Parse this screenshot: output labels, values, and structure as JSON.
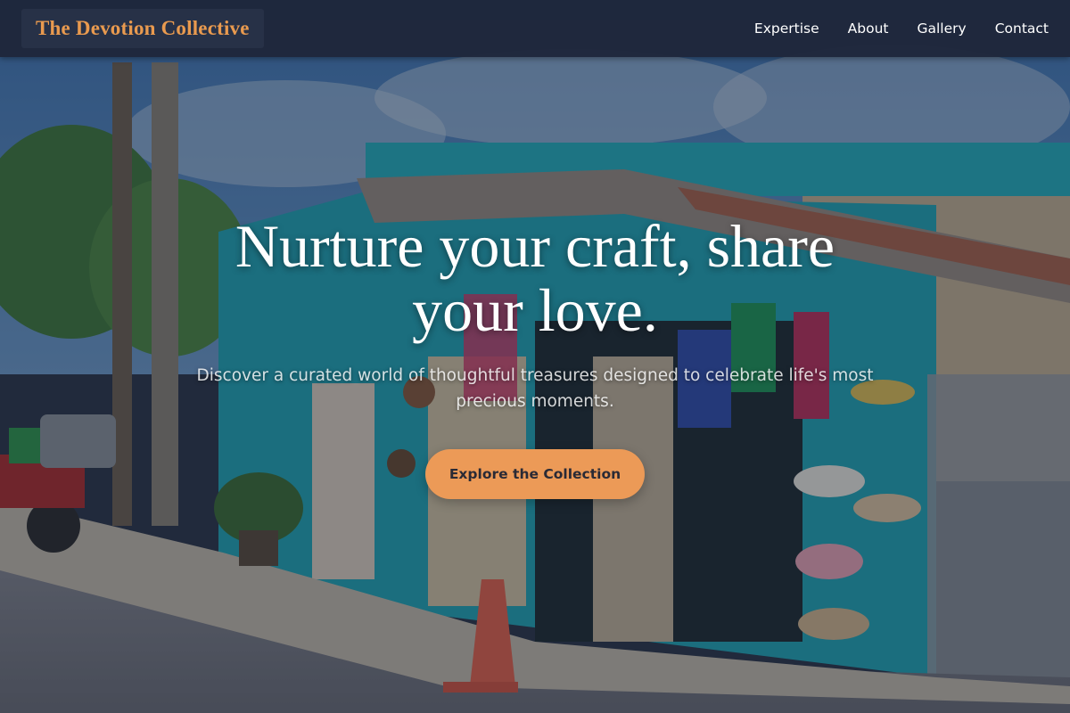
{
  "header": {
    "brand": "The Devotion Collective",
    "nav": [
      "Expertise",
      "About",
      "Gallery",
      "Contact"
    ]
  },
  "hero": {
    "title": "Nurture your craft, share your love.",
    "subtitle": "Discover a curated world of thoughtful treasures designed to celebrate life's most precious moments.",
    "cta_label": "Explore the Collection",
    "background": "photo-street-shop-with-hats-and-crafts"
  },
  "colors": {
    "header_bg": "#1e273a",
    "brand": "#e99a4f",
    "cta_bg": "#ec9a57",
    "cta_text": "#2a2a35",
    "text": "#ffffff"
  }
}
